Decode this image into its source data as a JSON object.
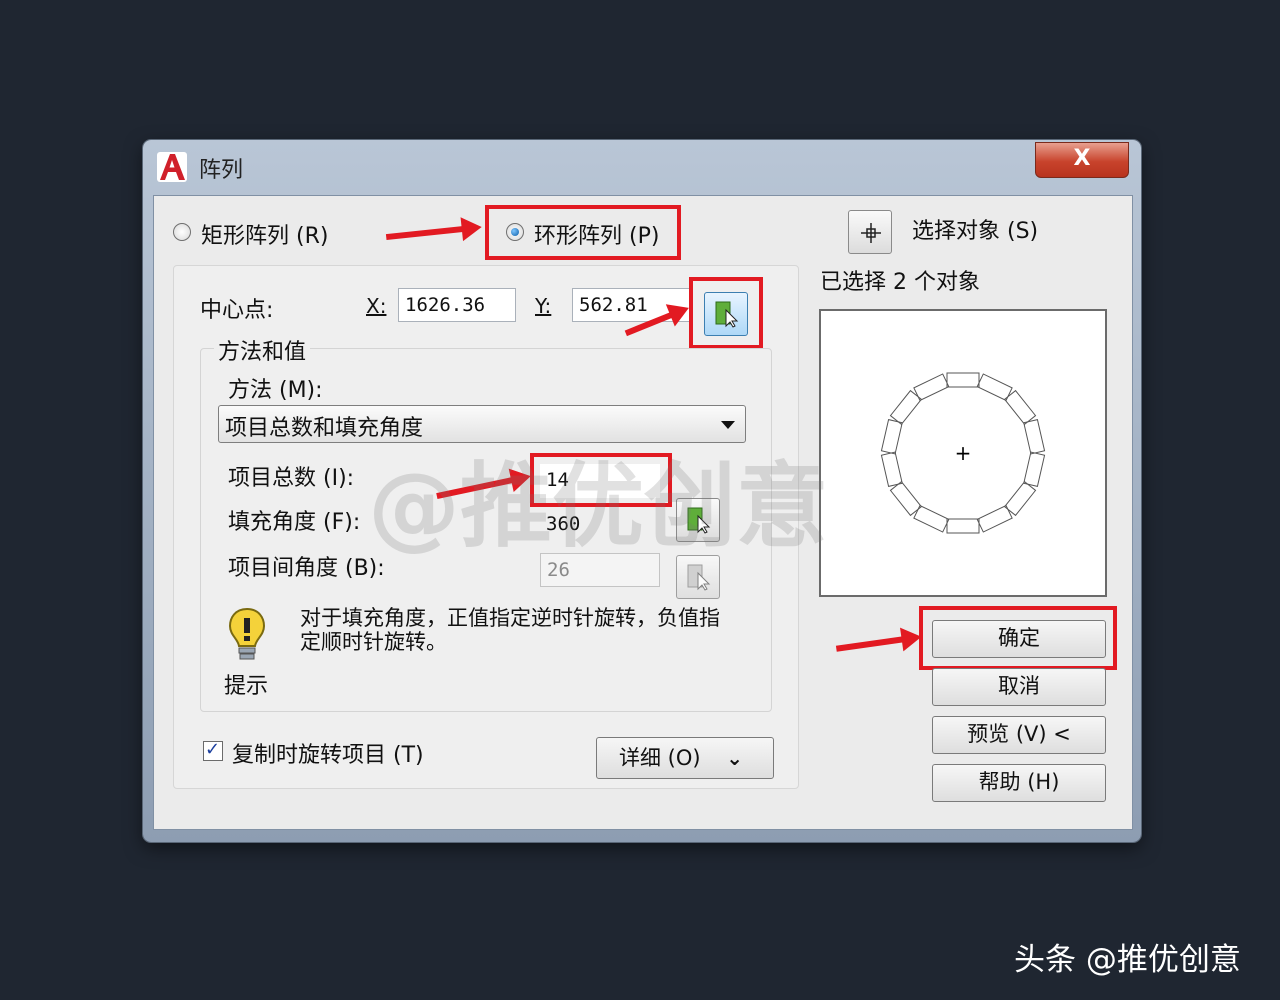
{
  "window": {
    "title": "阵列",
    "close_label": "X"
  },
  "array_type": {
    "rect_label": "矩形阵列 (R)",
    "polar_label": "环形阵列 (P)",
    "selected": "polar"
  },
  "center": {
    "label": "中心点:",
    "x_label": "X:",
    "x_value": "1626.36",
    "y_label": "Y:",
    "y_value": "562.81"
  },
  "method": {
    "group_label": "方法和值",
    "method_label": "方法 (M):",
    "method_selected": "项目总数和填充角度",
    "total_label": "项目总数 (I):",
    "total_value": "14",
    "fill_label": "填充角度 (F):",
    "fill_value": "360",
    "between_label": "项目间角度 (B):",
    "between_value": "26"
  },
  "tip": {
    "text": "对于填充角度，正值指定逆时针旋转，负值指定顺时针旋转。",
    "label": "提示"
  },
  "rotate_checkbox": {
    "label": "复制时旋转项目 (T)",
    "checked": true
  },
  "detail_button": "详细 (O)",
  "select_objects": {
    "label": "选择对象 (S)",
    "status": "已选择  2  个对象"
  },
  "buttons": {
    "ok": "确定",
    "cancel": "取消",
    "preview": "预览 (V)  <",
    "help": "帮助 (H)"
  },
  "watermark": "@推优创意",
  "credit": "头条 @推优创意",
  "colors": {
    "highlight": "#e21a22",
    "background": "#1f2631"
  }
}
